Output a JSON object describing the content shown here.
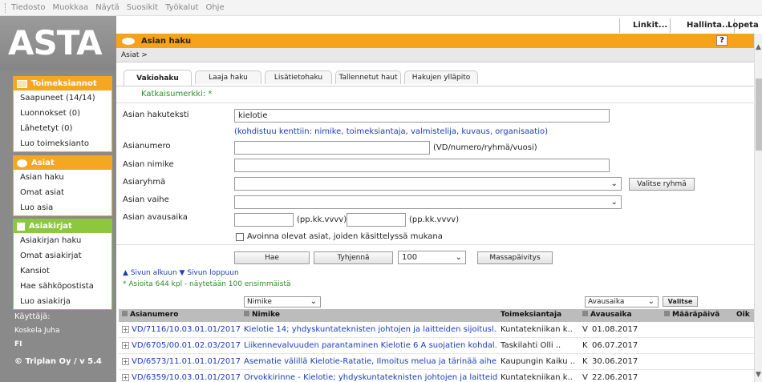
{
  "browser_menu": [
    "Tiedosto",
    "Muokkaa",
    "Näytä",
    "Suosikit",
    "Työkalut",
    "Ohje"
  ],
  "top_links": {
    "links": "Linkit...",
    "admin": "Hallinta...",
    "logout": "Lopeta"
  },
  "logo": "ASTA",
  "sidebar": {
    "groups": [
      {
        "title": "Toimeksiannot",
        "color": "#f5a623",
        "items": [
          "Saapuneet (14/14)",
          "Luonnokset (0)",
          "Lähetetyt (0)",
          "Luo toimeksianto"
        ]
      },
      {
        "title": "Asiat",
        "color": "#f5a623",
        "items": [
          "Asian haku",
          "Omat asiat",
          "Luo asia"
        ]
      },
      {
        "title": "Asiakirjat",
        "color": "#8dc63f",
        "items": [
          "Asiakirjan haku",
          "Omat asiakirjat",
          "Kansiot",
          "Hae sähköpostista",
          "Luo asiakirja"
        ]
      }
    ],
    "user_label": "Käyttäjä:",
    "user_name": "Koskela Juha",
    "language": "FI",
    "copyright": "© Triplan Oy / v 5.4"
  },
  "panel": {
    "title": "Asian haku",
    "help": "?",
    "breadcrumb": "Asiat >"
  },
  "tabs": [
    "Vakiohaku",
    "Laaja haku",
    "Lisätietohaku",
    "Tallennetut haut",
    "Hakujen ylläpito"
  ],
  "form": {
    "katkaisumerkki": "Katkaisumerkki: *",
    "search_text_label": "Asian hakuteksti",
    "search_text_value": "kielotie",
    "search_text_hint": "(kohdistuu kenttiin: nimike, toimeksiantaja, valmistelija, kuvaus, organisaatio)",
    "number_label": "Asianumero",
    "number_hint": "(VD/numero/ryhmä/vuosi)",
    "title_label": "Asian nimike",
    "group_label": "Asiaryhmä",
    "choose_group_button": "Valitse ryhmä",
    "phase_label": "Asian vaihe",
    "opened_label": "Asian avausaika",
    "date_hint_from": "(pp.kk.vvvv) -",
    "date_hint_to": "(pp.kk.vvvv)",
    "open_only_checkbox": "Avoinna olevat asiat, joiden käsittelyssä mukana",
    "search_button": "Hae",
    "clear_button": "Tyhjennä",
    "limit_value": "100",
    "bulk_update_button": "Massapäivitys"
  },
  "nav": {
    "to_top": "▲ Sivun alkuun",
    "to_bottom": "▼ Sivun loppuun"
  },
  "result_count": "* Asioita 644 kpl - näytetään 100 ensimmäistä",
  "table": {
    "filter_column": "Nimike",
    "date_filter": "Avausaika",
    "apply_button": "Valitse",
    "headers": [
      "Asianumero",
      "Nimike",
      "Toimeksiantaja",
      "Avausaika",
      "Määräpäivä",
      "Oik"
    ],
    "rows": [
      {
        "number": "VD/7116/10.03.01.01/2017",
        "title": "Kielotie 14; yhdyskuntateknisten johtojen ja laitteiden sijoitusl..",
        "client": "Kuntatekniikan k..",
        "flag": "V",
        "date": "01.08.2017"
      },
      {
        "number": "VD/6705/00.01.02.03/2017",
        "title": "Liikennevalvuuden parantaminen Kielotie 6 A suojatien kohdal..",
        "client": "Taskilahti Olli ..",
        "flag": "K",
        "date": "06.07.2017"
      },
      {
        "number": "VD/6573/11.01.01.01/2017",
        "title": "Asematie välillä Kielotie-Ratatie, Ilmoitus melua ja tärinää aihe..",
        "client": "Kaupungin Kaiku ..",
        "flag": "K",
        "date": "30.06.2017"
      },
      {
        "number": "VD/6359/10.03.01.01/2017",
        "title": "Orvokkirinne - Kielotie; yhdyskuntateknisten johtojen ja laitteid..",
        "client": "Kuntatekniikan k..",
        "flag": "V",
        "date": "22.06.2017"
      }
    ]
  }
}
